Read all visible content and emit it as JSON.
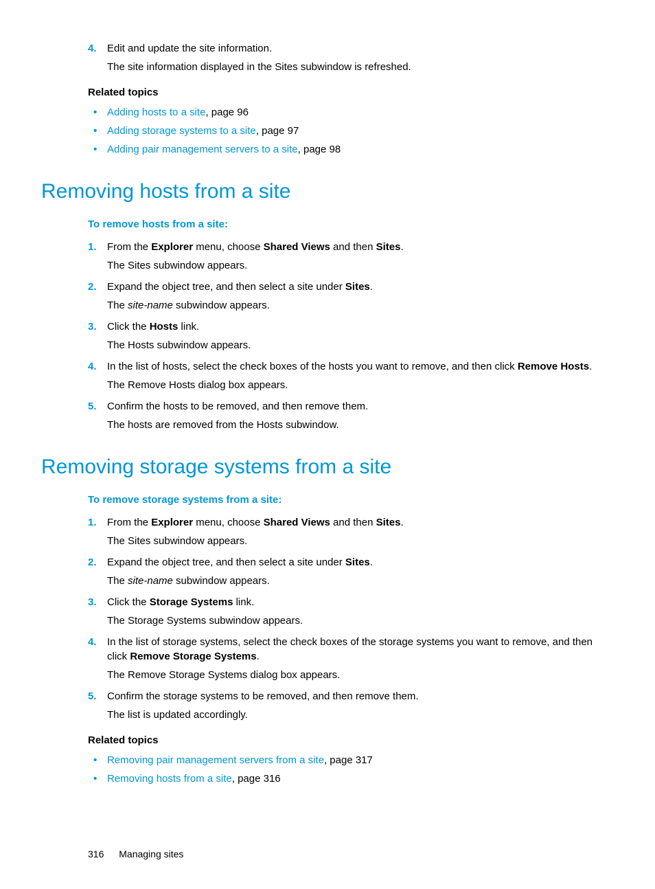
{
  "top": {
    "step4_a": "Edit and update the site information.",
    "step4_b": "The site information displayed in the Sites subwindow is refreshed.",
    "related_h": "Related topics",
    "rel1_link": "Adding hosts to a site",
    "rel1_tail": ", page 96",
    "rel2_link": "Adding storage systems to a site",
    "rel2_tail": ", page 97",
    "rel3_link": "Adding pair management servers to a site",
    "rel3_tail": ", page 98"
  },
  "hosts": {
    "h1": "Removing hosts from a site",
    "proc": "To remove hosts from a site:",
    "s1_pre": "From the ",
    "s1_b1": "Explorer",
    "s1_mid": " menu, choose ",
    "s1_b2": "Shared Views",
    "s1_mid2": " and then ",
    "s1_b3": "Sites",
    "s1_post": ".",
    "s1_res": "The Sites subwindow appears.",
    "s2_pre": "Expand the object tree, and then select a site under ",
    "s2_b": "Sites",
    "s2_post": ".",
    "s2_res_pre": "The ",
    "s2_res_i": "site-name",
    "s2_res_post": " subwindow appears.",
    "s3_pre": "Click the ",
    "s3_b": "Hosts",
    "s3_post": " link.",
    "s3_res": "The Hosts subwindow appears.",
    "s4_pre": "In the list of hosts, select the check boxes of the hosts you want to remove, and then click ",
    "s4_b": "Remove Hosts",
    "s4_post": ".",
    "s4_res": "The Remove Hosts dialog box appears.",
    "s5": "Confirm the hosts to be removed, and then remove them.",
    "s5_res": "The hosts are removed from the Hosts subwindow."
  },
  "storage": {
    "h1": "Removing storage systems from a site",
    "proc": "To remove storage systems from a site:",
    "s1_pre": "From the ",
    "s1_b1": "Explorer",
    "s1_mid": " menu, choose ",
    "s1_b2": "Shared Views",
    "s1_mid2": " and then ",
    "s1_b3": "Sites",
    "s1_post": ".",
    "s1_res": "The Sites subwindow appears.",
    "s2_pre": "Expand the object tree, and then select a site under ",
    "s2_b": "Sites",
    "s2_post": ".",
    "s2_res_pre": "The ",
    "s2_res_i": "site-name",
    "s2_res_post": " subwindow appears.",
    "s3_pre": "Click the ",
    "s3_b": "Storage Systems",
    "s3_post": " link.",
    "s3_res": "The Storage Systems subwindow appears.",
    "s4_pre": "In the list of storage systems, select the check boxes of the storage systems you want to remove, and then click ",
    "s4_b": "Remove Storage Systems",
    "s4_post": ".",
    "s4_res": "The Remove Storage Systems dialog box appears.",
    "s5": "Confirm the storage systems to be removed, and then remove them.",
    "s5_res": "The list is updated accordingly.",
    "related_h": "Related topics",
    "rel1_link": "Removing pair management servers from a site",
    "rel1_tail": ", page 317",
    "rel2_link": "Removing hosts from a site",
    "rel2_tail": ", page 316"
  },
  "footer": {
    "page": "316",
    "chapter": "Managing sites"
  }
}
